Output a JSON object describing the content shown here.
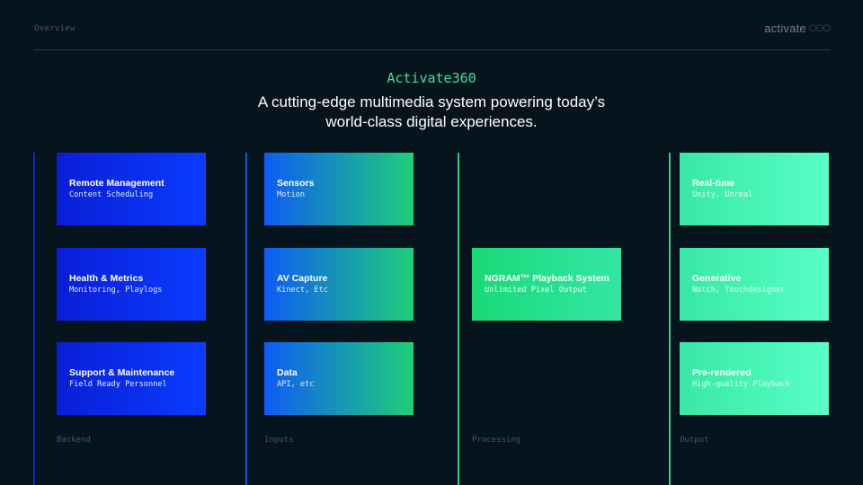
{
  "header": {
    "section_label": "Overview",
    "logo_text": "activate",
    "logo_mark": "◌◌◌"
  },
  "hero": {
    "brand": "Activate360",
    "tagline_line1": "A cutting-edge multimedia system powering today’s",
    "tagline_line2": "world-class digital experiences."
  },
  "columns": [
    {
      "label": "Backend",
      "cards": [
        {
          "title": "Remote Management",
          "subtitle": "Content Scheduling"
        },
        {
          "title": "Health & Metrics",
          "subtitle": "Monitoring, Playlogs"
        },
        {
          "title": "Support & Maintenance",
          "subtitle": "Field Ready Personnel"
        }
      ]
    },
    {
      "label": "Inputs",
      "cards": [
        {
          "title": "Sensors",
          "subtitle": "Motion"
        },
        {
          "title": "AV Capture",
          "subtitle": "Kinect, Etc"
        },
        {
          "title": "Data",
          "subtitle": "API, etc"
        }
      ]
    },
    {
      "label": "Processing",
      "cards": [
        {
          "title": "NGRAM™ Playback System",
          "subtitle": "Unlimited Pixel Output"
        }
      ]
    },
    {
      "label": "Output",
      "cards": [
        {
          "title": "Real-time",
          "subtitle": "Unity, Unreal"
        },
        {
          "title": "Generative",
          "subtitle": "Notch, Touchdesigner"
        },
        {
          "title": "Pre-rendered",
          "subtitle": "High-quality Playback"
        }
      ]
    }
  ],
  "colors": {
    "background": "#06141d",
    "backend_gradient": [
      "#0a1fd6",
      "#0a3bff"
    ],
    "inputs_gradient": [
      "#0f5cf2",
      "#1fcf78"
    ],
    "processing_gradient": [
      "#19d977",
      "#34e6a6"
    ],
    "output_gradient": [
      "#38e8a7",
      "#58ffc6"
    ],
    "accent_green": "#3ee39a",
    "line_blue": "#0b2dbf",
    "line_mid": "#1a55d8",
    "line_green": "#2ccf7c"
  }
}
